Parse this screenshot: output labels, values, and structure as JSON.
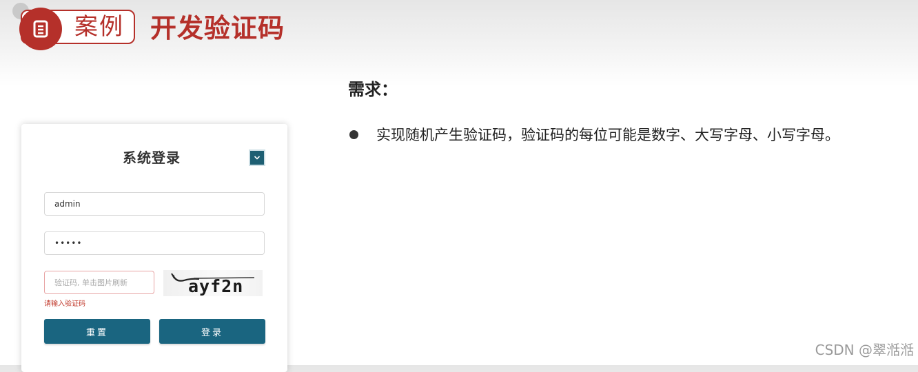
{
  "header": {
    "badge_label": "案例",
    "title": "开发验证码",
    "badge_icon": "document-icon",
    "accent_color": "#b5302a"
  },
  "requirement": {
    "heading": "需求：",
    "items": [
      "实现随机产生验证码，验证码的每位可能是数字、大写字母、小写字母。"
    ]
  },
  "login": {
    "title": "系统登录",
    "collapse_icon": "chevron-down-icon",
    "username_value": "admin",
    "password_value": "•••••",
    "captcha_placeholder": "验证码, 单击图片刷新",
    "captcha_image_text": "ayf2n",
    "captcha_error": "请输入验证码",
    "reset_label": "重置",
    "login_label": "登录",
    "button_color": "#1a6580"
  },
  "watermark": "CSDN @翠湉湉"
}
